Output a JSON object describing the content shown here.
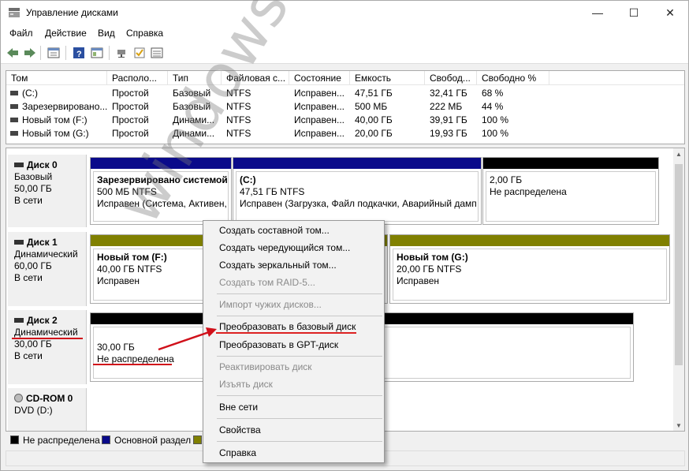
{
  "window": {
    "title": "Управление дисками"
  },
  "menu": [
    "Файл",
    "Действие",
    "Вид",
    "Справка"
  ],
  "volume_list": {
    "columns": [
      "Том",
      "Располо...",
      "Тип",
      "Файловая с...",
      "Состояние",
      "Емкость",
      "Свобод...",
      "Свободно %"
    ],
    "rows": [
      [
        "(C:)",
        "Простой",
        "Базовый",
        "NTFS",
        "Исправен...",
        "47,51 ГБ",
        "32,41 ГБ",
        "68 %"
      ],
      [
        "Зарезервировано...",
        "Простой",
        "Базовый",
        "NTFS",
        "Исправен...",
        "500 МБ",
        "222 МБ",
        "44 %"
      ],
      [
        "Новый том (F:)",
        "Простой",
        "Динами...",
        "NTFS",
        "Исправен...",
        "40,00 ГБ",
        "39,91 ГБ",
        "100 %"
      ],
      [
        "Новый том (G:)",
        "Простой",
        "Динами...",
        "NTFS",
        "Исправен...",
        "20,00 ГБ",
        "19,93 ГБ",
        "100 %"
      ]
    ]
  },
  "disks": [
    {
      "name": "Диск 0",
      "type": "Базовый",
      "size": "50,00 ГБ",
      "status": "В сети",
      "partitions": [
        {
          "name": "Зарезервировано системой",
          "size": "500 МБ NTFS",
          "status": "Исправен (Система, Активен, ..."
        },
        {
          "name": "(C:)",
          "size": "47,51 ГБ NTFS",
          "status": "Исправен (Загрузка, Файл подкачки, Аварийный дамп"
        },
        {
          "name": "",
          "size": "2,00 ГБ",
          "status": "Не распределена"
        }
      ]
    },
    {
      "name": "Диск 1",
      "type": "Динамический",
      "size": "60,00 ГБ",
      "status": "В сети",
      "partitions": [
        {
          "name": "Новый том (F:)",
          "size": "40,00 ГБ NTFS",
          "status": "Исправен"
        },
        {
          "name": "Новый том (G:)",
          "size": "20,00 ГБ NTFS",
          "status": "Исправен"
        }
      ]
    },
    {
      "name": "Диск 2",
      "type": "Динамический",
      "size": "30,00 ГБ",
      "status": "В сети",
      "partitions": [
        {
          "name": "",
          "size": "30,00 ГБ",
          "status": "Не распределена"
        }
      ]
    },
    {
      "name": "CD-ROM 0",
      "type": "DVD (D:)"
    }
  ],
  "legend": [
    {
      "label": "Не распределена",
      "color": "#000000"
    },
    {
      "label": "Основной раздел",
      "color": "#0a0a8a"
    },
    {
      "label": "",
      "color": "#808000"
    }
  ],
  "context_menu": {
    "items": [
      {
        "label": "Создать составной том...",
        "enabled": true
      },
      {
        "label": "Создать чередующийся том...",
        "enabled": true
      },
      {
        "label": "Создать зеркальный том...",
        "enabled": true
      },
      {
        "label": "Создать том RAID-5...",
        "enabled": false
      },
      {
        "label": "Импорт чужих дисков...",
        "enabled": false
      },
      {
        "label": "Преобразовать в базовый диск",
        "enabled": true
      },
      {
        "label": "Преобразовать в GPT-диск",
        "enabled": true
      },
      {
        "label": "Реактивировать диск",
        "enabled": false
      },
      {
        "label": "Изъять диск",
        "enabled": false
      },
      {
        "label": "Вне сети",
        "enabled": true
      },
      {
        "label": "Свойства",
        "enabled": true
      },
      {
        "label": "Справка",
        "enabled": true
      }
    ]
  },
  "watermark": "windowstips.ru",
  "colors": {
    "basic_bar": "#0a0a8a",
    "dynamic_bar": "#808000",
    "unallocated_bar": "#000000",
    "annotation": "#d0101a"
  }
}
